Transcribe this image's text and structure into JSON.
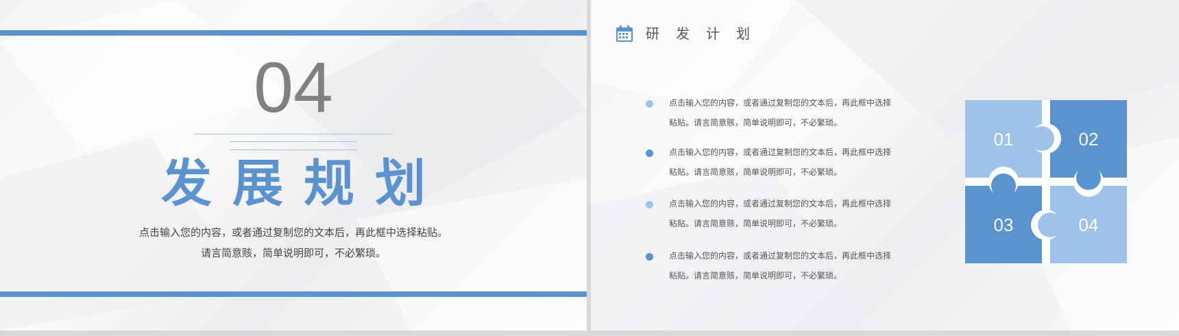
{
  "colors": {
    "accent": "#5a93d0",
    "accent_light": "#9dc3e8",
    "number_gray": "#808080",
    "text": "#444444"
  },
  "left_slide": {
    "section_number": "04",
    "heading": "发展规划",
    "subtext_lines": [
      "点击输入您的内容，或者通过复制您的文本后，再此框中选择粘贴。",
      "请言简意赅，简单说明即可，不必繁琐。"
    ]
  },
  "right_slide": {
    "icon": "calendar-icon",
    "title": "研发计划",
    "items": [
      {
        "line1": "点击输入您的内容，或者通过复制您的文本后，再此框中选择",
        "line2": "粘贴。请言简意赅，简单说明即可，不必繁琐。",
        "dot": "light"
      },
      {
        "line1": "点击输入您的内容，或者通过复制您的文本后，再此框中选择",
        "line2": "粘贴。请言简意赅，简单说明即可，不必繁琐。",
        "dot": "dark"
      },
      {
        "line1": "点击输入您的内容，或者通过复制您的文本后，再此框中选择",
        "line2": "粘贴。请言简意赅，简单说明即可，不必繁琐。",
        "dot": "light"
      },
      {
        "line1": "点击输入您的内容，或者通过复制您的文本后，再此框中选择",
        "line2": "粘贴。请言简意赅，简单说明即可，不必繁琐。",
        "dot": "dark"
      }
    ],
    "puzzle": [
      "01",
      "02",
      "03",
      "04"
    ]
  }
}
